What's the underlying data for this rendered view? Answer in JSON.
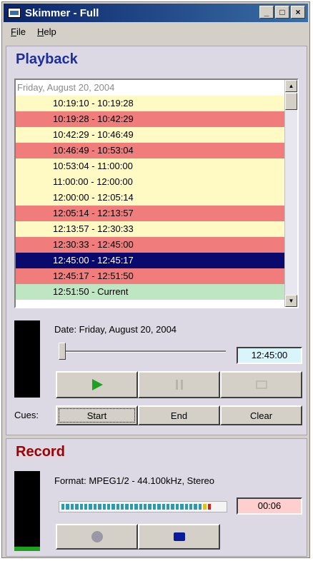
{
  "window": {
    "title": "Skimmer - Full",
    "min_glyph": "_",
    "max_glyph": "□",
    "close_glyph": "×"
  },
  "menu": {
    "file": "File",
    "help": "Help"
  },
  "playback": {
    "heading": "Playback",
    "list_header": "Friday, August 20, 2004",
    "rows": [
      {
        "text": "10:19:10 - 10:19:28",
        "state": "normal"
      },
      {
        "text": "10:19:28 - 10:42:29",
        "state": "alert"
      },
      {
        "text": "10:42:29 - 10:46:49",
        "state": "normal"
      },
      {
        "text": "10:46:49 - 10:53:04",
        "state": "alert"
      },
      {
        "text": "10:53:04 - 11:00:00",
        "state": "normal"
      },
      {
        "text": "11:00:00 - 12:00:00",
        "state": "normal"
      },
      {
        "text": "12:00:00 - 12:05:14",
        "state": "normal"
      },
      {
        "text": "12:05:14 - 12:13:57",
        "state": "alert"
      },
      {
        "text": "12:13:57 - 12:30:33",
        "state": "normal"
      },
      {
        "text": "12:30:33 - 12:45:00",
        "state": "alert"
      },
      {
        "text": "12:45:00 - 12:45:17",
        "state": "selected"
      },
      {
        "text": "12:45:17 - 12:51:50",
        "state": "alert"
      },
      {
        "text": "12:51:50 - Current",
        "state": "current"
      }
    ],
    "date_label": "Date: Friday, August 20, 2004",
    "position_time": "12:45:00",
    "slider_position": 0.0,
    "cues_label": "Cues:",
    "cue_buttons": {
      "start": "Start",
      "end": "End",
      "clear": "Clear"
    },
    "colors": {
      "normal": "#fff9c4",
      "alert": "#f07c7c",
      "selected": "#0a0a6e",
      "current": "#bfe6c3",
      "time_box": "#d9f4fb"
    }
  },
  "record": {
    "heading": "Record",
    "format_label": "Format: MPEG1/2 - 44.100kHz, Stereo",
    "elapsed_time": "00:06",
    "colors": {
      "time_box": "#ffcece",
      "heading": "#a00000",
      "level_green": "#1ca21c",
      "stop_blue": "#0a1a9a"
    }
  },
  "icons": {
    "play": "play-icon",
    "pause": "pause-icon",
    "stop": "stop-icon",
    "record": "record-icon",
    "stop_record": "stop-record-icon"
  }
}
